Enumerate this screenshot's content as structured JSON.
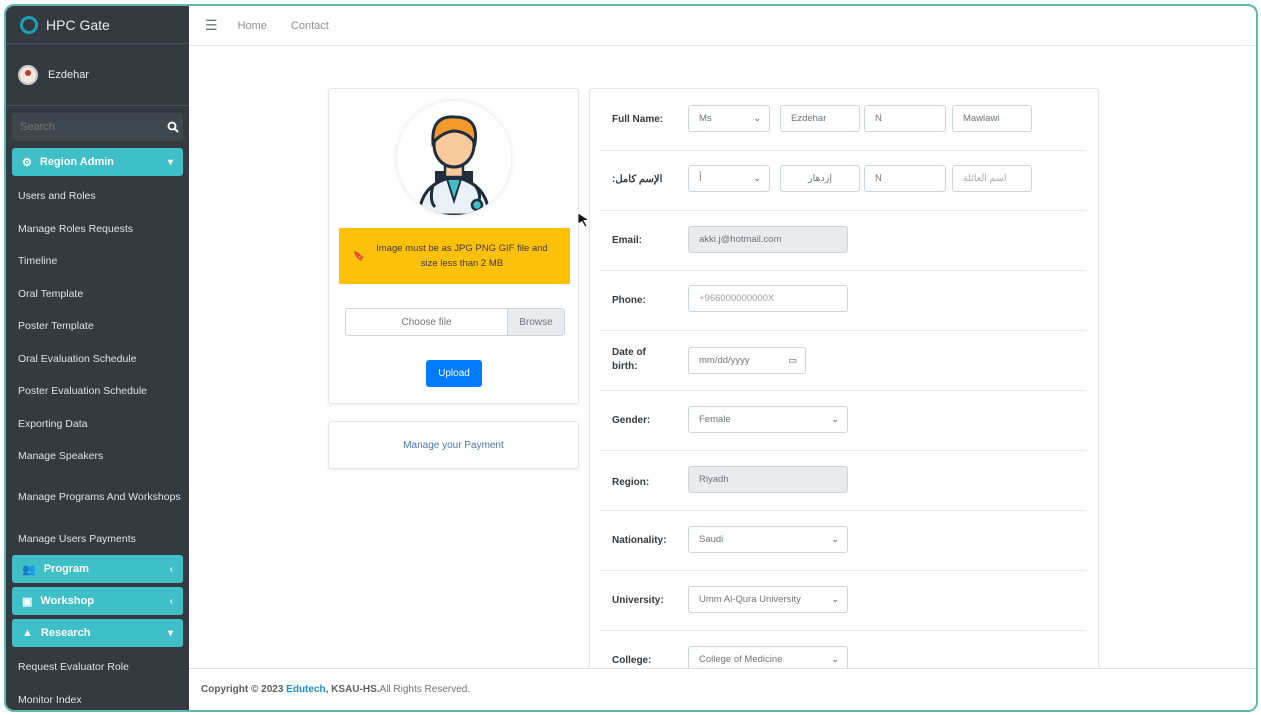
{
  "brand": {
    "title": "HPC Gate"
  },
  "user": {
    "name": "Ezdehar"
  },
  "search": {
    "placeholder": "Search"
  },
  "sidebar": {
    "region_admin": "Region Admin",
    "items": [
      "Users and Roles",
      "Manage Roles Requests",
      "Timeline",
      "Oral Template",
      "Poster Template",
      "Oral Evaluation Schedule",
      "Poster Evaluation Schedule",
      "Exporting Data",
      "Manage Speakers",
      "Manage Programs And Workshops",
      "Manage Users Payments"
    ],
    "program": "Program",
    "workshop": "Workshop",
    "research": "Research",
    "research_items": [
      "Request Evaluator Role",
      "Monitor Index"
    ]
  },
  "topbar": {
    "home": "Home",
    "contact": "Contact"
  },
  "profile": {
    "warning": "Image must be as JPG PNG GIF file and size less than 2 MB",
    "choose_file": "Choose file",
    "browse": "Browse",
    "upload": "Upload",
    "manage_payment": "Manage your Payment"
  },
  "form": {
    "full_name_label": "Full Name:",
    "title_value": "Ms",
    "first_name": "Ezdehar",
    "middle_name": "N",
    "last_name": "Mawlawi",
    "arabic_label": ":الإسم كامل",
    "arabic_title": "أ",
    "arabic_first": "إزدهار",
    "arabic_middle": "N",
    "arabic_last_placeholder": "اسم العائلة",
    "email_label": "Email:",
    "email_value": "akki.j@hotmail.com",
    "phone_label": "Phone:",
    "phone_value": "+966000000000X",
    "dob_label": "Date of birth:",
    "dob_value": "mm/dd/yyyy",
    "gender_label": "Gender:",
    "gender_value": "Female",
    "region_label": "Region:",
    "region_value": "Riyadh",
    "nationality_label": "Nationality:",
    "nationality_value": "Saudi",
    "university_label": "University:",
    "university_value": "Umm Al-Qura University",
    "college_label": "College:",
    "college_value": "College of Medicine"
  },
  "footer": {
    "prefix": "Copyright © 2023",
    "company": "Edutech",
    "suffix_bold": ", KSAU-HS.",
    "suffix": "All Rights Reserved."
  },
  "colors": {
    "accent": "#3fbfc7",
    "sidebar": "#343a40",
    "warning": "#ffc107",
    "primary": "#007bff"
  }
}
